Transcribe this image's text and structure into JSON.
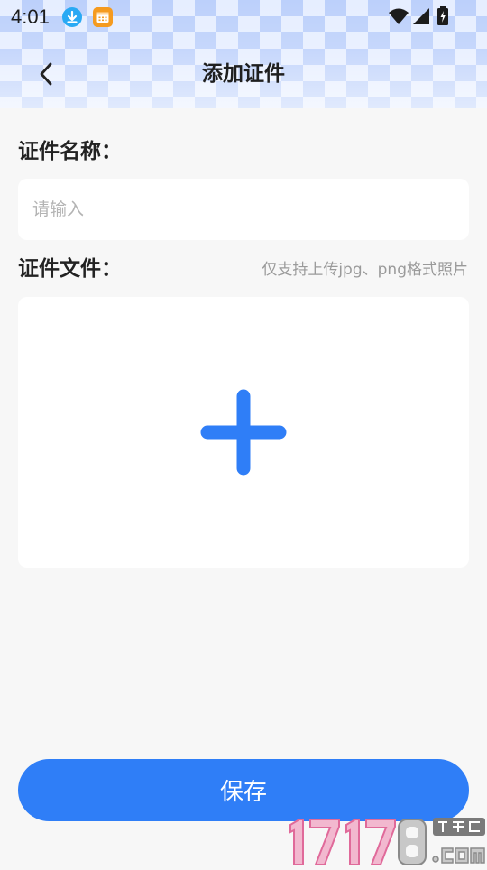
{
  "status_bar": {
    "time": "4:01",
    "notification_icons": [
      "download-icon",
      "calendar-icon"
    ],
    "system_icons": [
      "wifi-icon",
      "signal-icon",
      "battery-icon"
    ]
  },
  "header": {
    "title": "添加证件",
    "back_icon": "chevron-left-icon"
  },
  "form": {
    "name_label": "证件名称：",
    "name_placeholder": "请输入",
    "name_value": "",
    "file_label": "证件文件：",
    "file_hint": "仅支持上传jpg、png格式照片",
    "upload_icon": "plus-icon"
  },
  "actions": {
    "save_label": "保存"
  },
  "colors": {
    "accent": "#2f7ef7",
    "background": "#f7f7f7",
    "card": "#ffffff",
    "hint": "#9a9a9a"
  }
}
